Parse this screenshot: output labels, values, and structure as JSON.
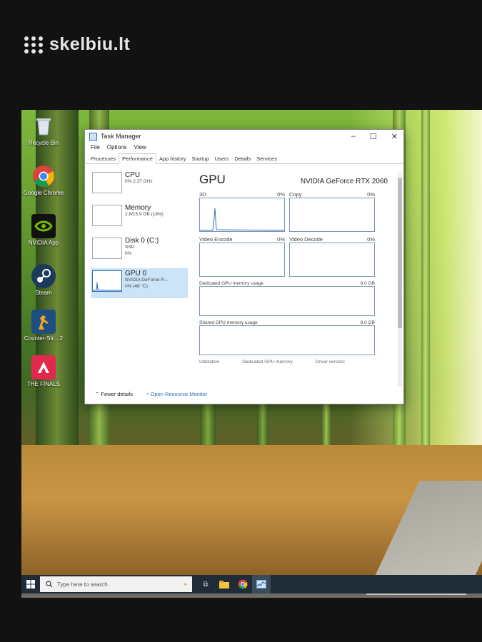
{
  "watermark": {
    "text": "skelbiu.lt"
  },
  "desktop_icons": [
    {
      "label": "Recycle Bin",
      "icon": "recycle-bin-icon"
    },
    {
      "label": "Google Chrome",
      "icon": "chrome-icon"
    },
    {
      "label": "NVIDIA App",
      "icon": "nvidia-icon"
    },
    {
      "label": "Steam",
      "icon": "steam-icon"
    },
    {
      "label": "Counter-Str... 2",
      "icon": "counter-strike-icon"
    },
    {
      "label": "THE FINALS",
      "icon": "the-finals-icon"
    }
  ],
  "task_manager": {
    "title": "Task Manager",
    "menu": [
      "File",
      "Options",
      "View"
    ],
    "tabs": [
      "Processes",
      "Performance",
      "App history",
      "Startup",
      "Users",
      "Details",
      "Services"
    ],
    "active_tab": "Performance",
    "resources": [
      {
        "name": "CPU",
        "sub1": "0% 2.37 GHz",
        "sub2": ""
      },
      {
        "name": "Memory",
        "sub1": "2.8/15.9 GB (18%)",
        "sub2": ""
      },
      {
        "name": "Disk 0 (C:)",
        "sub1": "SSD",
        "sub2": "0%"
      },
      {
        "name": "GPU 0",
        "sub1": "NVIDIA GeForce R...",
        "sub2": "0% (48 °C)"
      }
    ],
    "gpu": {
      "title": "GPU",
      "model": "NVIDIA GeForce RTX 2060",
      "graphs": [
        {
          "label": "3D",
          "value": "0%"
        },
        {
          "label": "Copy",
          "value": "0%"
        },
        {
          "label": "Video Encode",
          "value": "0%"
        },
        {
          "label": "Video Decode",
          "value": "0%"
        }
      ],
      "dedicated_label": "Dedicated GPU memory usage",
      "dedicated_max": "6.0 GB",
      "shared_label": "Shared GPU memory usage",
      "shared_max": "8.0 GB",
      "stats_headers": [
        "Utilization",
        "Dedicated GPU memory",
        "Driver version:"
      ]
    },
    "footer": {
      "fewer_details": "Fewer details",
      "open_monitor": "Open Resource Monitor"
    }
  },
  "taskbar": {
    "search_placeholder": "Type here to search"
  },
  "colors": {
    "accent": "#2d6fb7",
    "selected": "#cce4f7",
    "taskbar": "#1f2b36"
  }
}
